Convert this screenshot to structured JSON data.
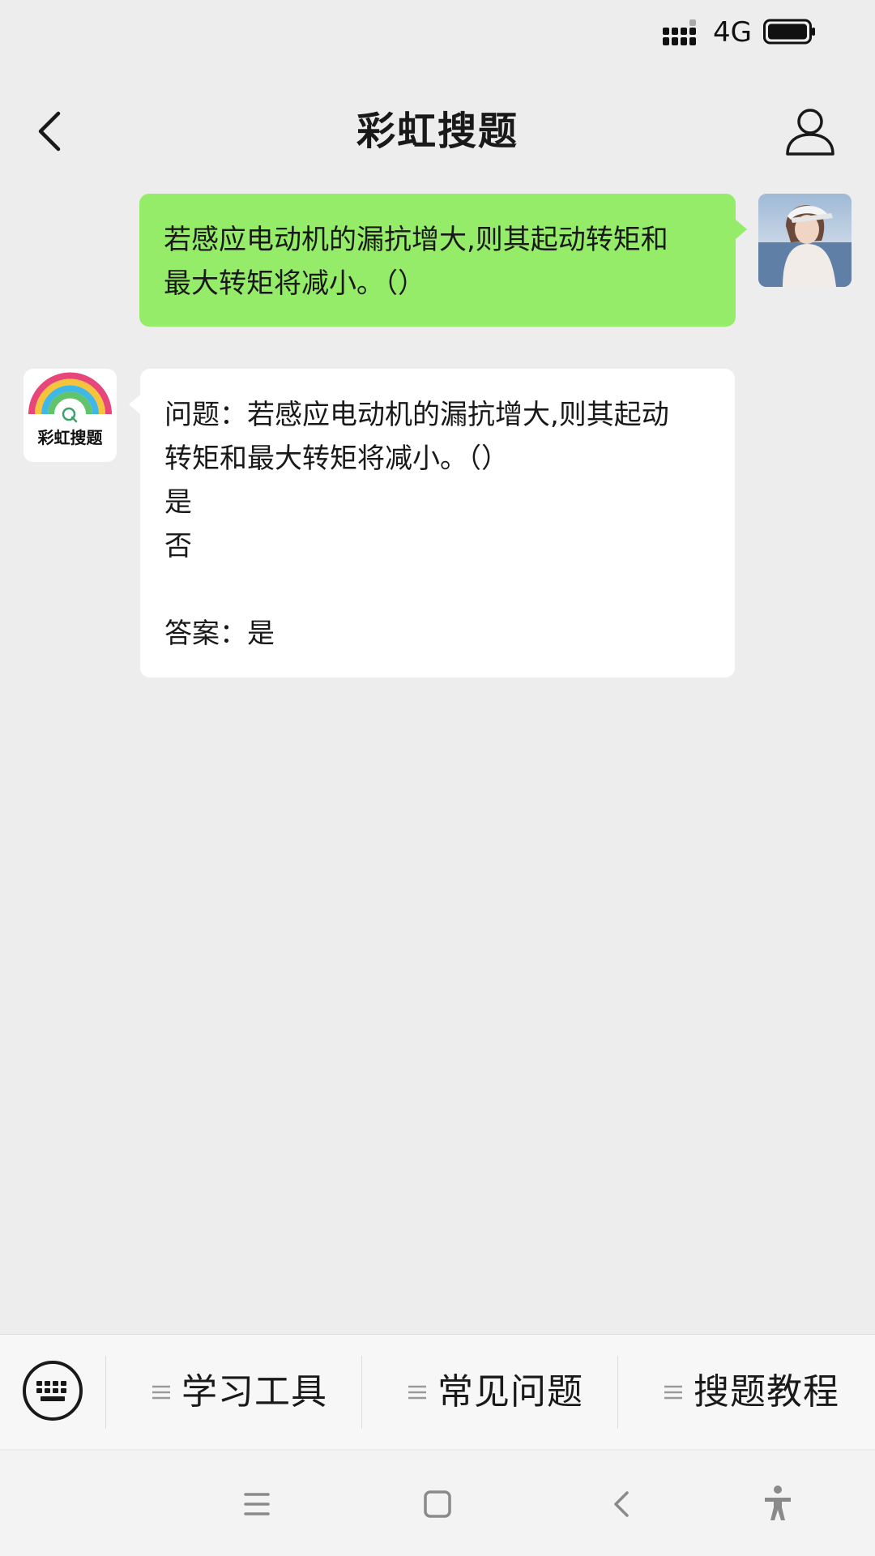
{
  "status_bar": {
    "network": "4G",
    "icons": [
      "signal-icon",
      "battery-icon"
    ]
  },
  "header": {
    "title": "彩虹搜题",
    "back_icon": "chevron-left-icon",
    "profile_icon": "person-icon"
  },
  "chat": {
    "user_message": {
      "lines": [
        "若感应电动机的漏抗增大,则其起动转矩和",
        "最大转矩将减小。（）"
      ]
    },
    "bot": {
      "logo_text": "彩虹搜题",
      "lines": [
        "问题：若感应电动机的漏抗增大,则其起动",
        "转矩和最大转矩将减小。（）",
        "是",
        "否",
        "",
        "答案：是"
      ]
    }
  },
  "menu": {
    "keyboard_icon": "keyboard-icon",
    "items": [
      {
        "label": "学习工具",
        "icon": "menu-lines-icon"
      },
      {
        "label": "常见问题",
        "icon": "menu-lines-icon"
      },
      {
        "label": "搜题教程",
        "icon": "menu-lines-icon"
      }
    ]
  },
  "nav": {
    "icons": [
      "menu-icon",
      "home-icon",
      "back-icon",
      "accessibility-icon"
    ]
  },
  "colors": {
    "background": "#ededed",
    "user_bubble": "#95ec69",
    "bot_bubble": "#ffffff"
  }
}
